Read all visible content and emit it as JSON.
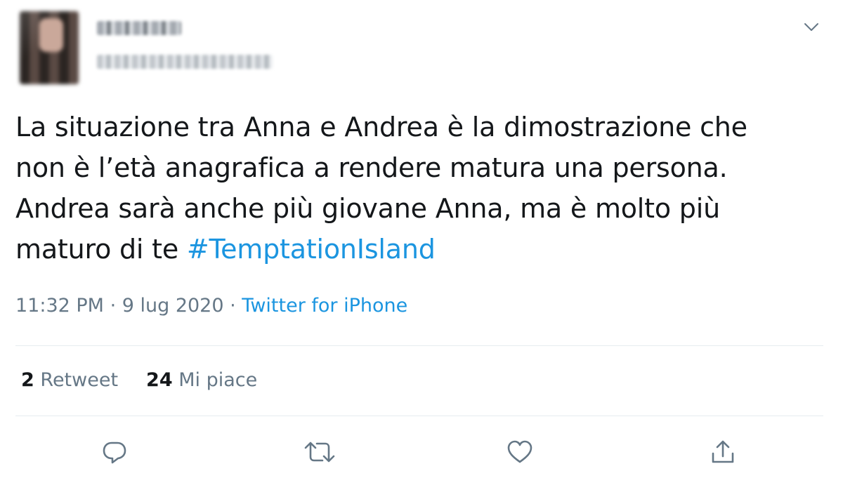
{
  "tweet": {
    "text_before": "La situazione tra Anna e Andrea è la dimostrazione che\nnon è l’età anagrafica a rendere matura una persona.\nAndrea sarà anche più giovane Anna, ma è molto più\nmaturo di te ",
    "hashtag": "#TemptationIsland",
    "time": "11:32 PM",
    "sep1": " · ",
    "date": "9 lug 2020",
    "sep2": " · ",
    "source": "Twitter for iPhone"
  },
  "stats": {
    "retweets_count": "2",
    "retweets_label": "Retweet",
    "likes_count": "24",
    "likes_label": "Mi piace"
  },
  "icons": {
    "more": "chevron-down-icon",
    "reply": "reply-icon",
    "retweet": "retweet-icon",
    "like": "heart-icon",
    "share": "share-icon"
  },
  "colors": {
    "text": "#14171a",
    "secondary": "#657786",
    "link": "#1b95e0",
    "divider": "#e6ecf0"
  }
}
